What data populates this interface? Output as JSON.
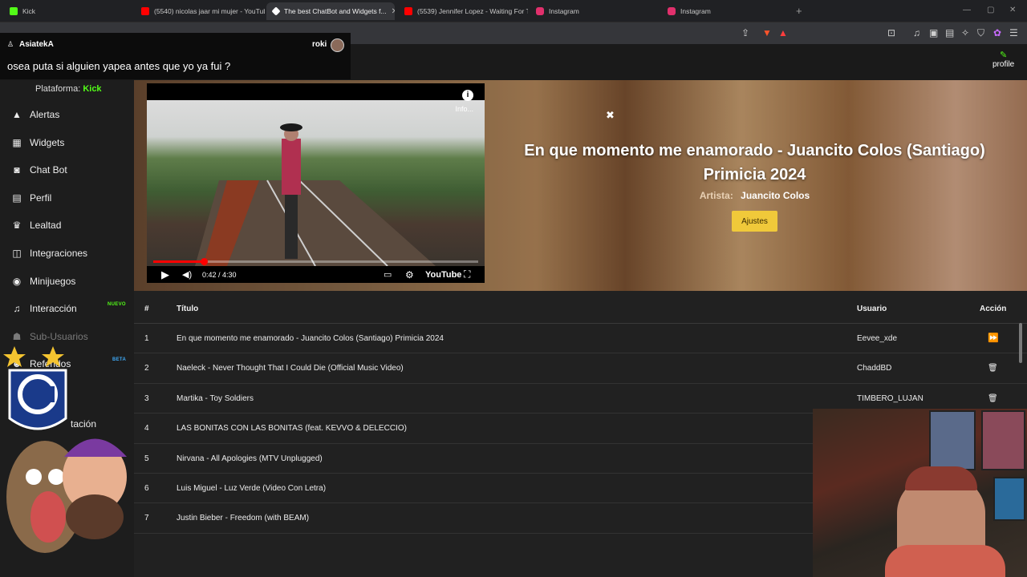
{
  "browser": {
    "tabs": [
      {
        "title": "Kick",
        "fav_color": "#53fc18"
      },
      {
        "title": "(5540) nicolas jaar mi mujer - YouTube",
        "fav_color": "#ff0000"
      },
      {
        "title": "The best ChatBot and Widgets f...",
        "fav_color": "#ffffff"
      },
      {
        "title": "(5539) Jennifer Lopez - Waiting For T...",
        "fav_color": "#ff0000"
      },
      {
        "title": "Instagram",
        "fav_color": "#e1306c"
      },
      {
        "title": "Instagram",
        "fav_color": "#e1306c"
      }
    ],
    "new_tab": "+"
  },
  "chat_overlay": {
    "username": "AsiatekA",
    "streamer": "roki",
    "message": "osea puta si alguien yapea antes que yo ya fui ?"
  },
  "header": {
    "profile_label": "profile"
  },
  "sidebar": {
    "platform_label": "Plataforma:",
    "platform_value": "Kick",
    "items": [
      {
        "label": "Alertas",
        "icon": "warning-icon"
      },
      {
        "label": "Widgets",
        "icon": "grid-icon"
      },
      {
        "label": "Chat Bot",
        "icon": "robot-icon"
      },
      {
        "label": "Perfil",
        "icon": "id-card-icon"
      },
      {
        "label": "Lealtad",
        "icon": "trophy-icon"
      },
      {
        "label": "Integraciones",
        "icon": "plug-icon"
      },
      {
        "label": "Minijuegos",
        "icon": "gamepad-icon"
      },
      {
        "label": "Interacción",
        "icon": "music-icon",
        "badge": "NUEVO"
      },
      {
        "label": "Sub-Usuarios",
        "icon": "users-icon"
      },
      {
        "label": "Referidos",
        "icon": "user-plus-icon",
        "badge": "BETA"
      }
    ],
    "partial_item": "tación"
  },
  "player": {
    "info_label": "Info...",
    "time": "0:42 / 4:30",
    "youtube_label": "YouTube",
    "progress": 0.155
  },
  "now_playing": {
    "title": "En que momento me enamorado - Juancito Colos (Santiago) Primicia 2024",
    "artist_label": "Artista:",
    "artist": "Juancito Colos",
    "settings_button": "Ajustes"
  },
  "queue": {
    "headers": {
      "num": "#",
      "title": "Título",
      "user": "Usuario",
      "action": "Acción"
    },
    "rows": [
      {
        "num": "1",
        "title": "En que momento me enamorado - Juancito Colos (Santiago) Primicia 2024",
        "user": "Eevee_xde",
        "action": "skip"
      },
      {
        "num": "2",
        "title": "Naeleck - Never Thought That I Could Die (Official Music Video)",
        "user": "ChaddBD",
        "action": "delete"
      },
      {
        "num": "3",
        "title": "Martika - Toy Soldiers",
        "user": "TIMBERO_LUJAN",
        "action": "delete"
      },
      {
        "num": "4",
        "title": "LAS BONITAS CON LAS BONITAS (feat. KEVVO & DELECCIO)",
        "user": "",
        "action": ""
      },
      {
        "num": "5",
        "title": "Nirvana - All Apologies (MTV Unplugged)",
        "user": "",
        "action": ""
      },
      {
        "num": "6",
        "title": "Luis Miguel - Luz Verde (Video Con Letra)",
        "user": "",
        "action": ""
      },
      {
        "num": "7",
        "title": "Justin Bieber - Freedom (with BEAM)",
        "user": "",
        "action": ""
      }
    ]
  },
  "colors": {
    "kick_green": "#53fc18",
    "accent_yellow": "#f0c93a",
    "youtube_red": "#ff0000"
  }
}
